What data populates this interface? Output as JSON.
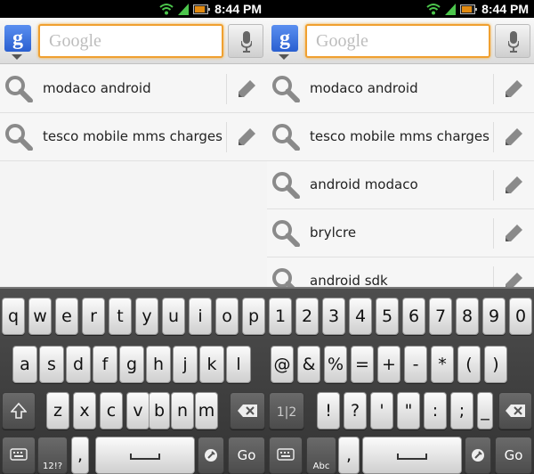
{
  "status_bar": {
    "time": "8:44 PM"
  },
  "search": {
    "placeholder": "Google",
    "logo_letter": "g"
  },
  "left": {
    "suggestions": [
      {
        "text": "modaco android"
      },
      {
        "text": "tesco mobile mms charges"
      }
    ]
  },
  "right": {
    "suggestions": [
      {
        "text": "modaco android"
      },
      {
        "text": "tesco mobile mms charges"
      },
      {
        "text": "android modaco"
      },
      {
        "text": "brylcre"
      },
      {
        "text": "android sdk"
      }
    ]
  },
  "keyboard_letters": {
    "row1": [
      "q",
      "w",
      "e",
      "r",
      "t",
      "y",
      "u",
      "i",
      "o",
      "p"
    ],
    "row2": [
      "a",
      "s",
      "d",
      "f",
      "g",
      "h",
      "j",
      "k",
      "l"
    ],
    "row3": [
      "z",
      "x",
      "c",
      "v",
      "b",
      "n",
      "m"
    ],
    "symbol_toggle": "12!?",
    "page_indicator": "1|2",
    "go": "Go",
    "comma": ","
  },
  "keyboard_symbols": {
    "row1": [
      "1",
      "2",
      "3",
      "4",
      "5",
      "6",
      "7",
      "8",
      "9",
      "0"
    ],
    "row2": [
      "@",
      "&",
      "%",
      "=",
      "+",
      "-",
      "*",
      "(",
      ")"
    ],
    "row3": [
      "!",
      "?",
      "'",
      "\"",
      ":",
      ";",
      "_"
    ],
    "alpha_toggle": "Abc",
    "go": "Go",
    "comma": ","
  },
  "colors": {
    "search_focus_border": "#f0a030",
    "google_logo_blue": "#3b6fe0",
    "battery": "#e28a10",
    "wifi_signal": "#4cc64c"
  },
  "icons": [
    "wifi-icon",
    "signal-icon",
    "battery-icon",
    "mic-icon",
    "search-icon",
    "edit-pencil-icon",
    "shift-icon",
    "backspace-icon",
    "settings-icon",
    "emoji-icon"
  ]
}
